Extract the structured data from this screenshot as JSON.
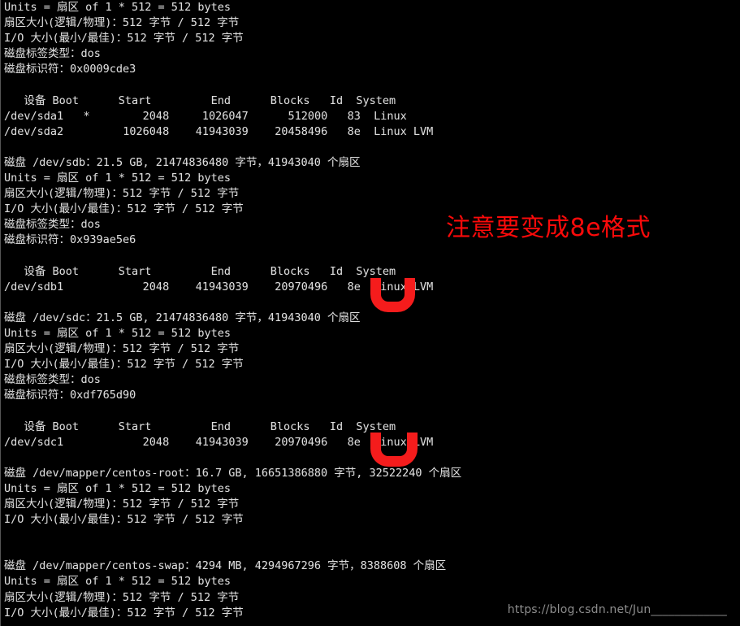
{
  "terminal": {
    "background_color": "#000000",
    "foreground_color": "#dcdcdc",
    "accent_color": "#fb0a0a",
    "console_text": "Units = 扇区 of 1 * 512 = 512 bytes\n扇区大小(逻辑/物理)：512 字节 / 512 字节\nI/O 大小(最小/最佳)：512 字节 / 512 字节\n磁盘标签类型：dos\n磁盘标识符：0x0009cde3\n\n   设备 Boot      Start         End      Blocks   Id  System\n/dev/sda1   *        2048     1026047      512000   83  Linux\n/dev/sda2         1026048    41943039    20458496   8e  Linux LVM\n\n磁盘 /dev/sdb：21.5 GB, 21474836480 字节，41943040 个扇区\nUnits = 扇区 of 1 * 512 = 512 bytes\n扇区大小(逻辑/物理)：512 字节 / 512 字节\nI/O 大小(最小/最佳)：512 字节 / 512 字节\n磁盘标签类型：dos\n磁盘标识符：0x939ae5e6\n\n   设备 Boot      Start         End      Blocks   Id  System\n/dev/sdb1            2048    41943039    20970496   8e  Linux LVM\n\n磁盘 /dev/sdc：21.5 GB, 21474836480 字节，41943040 个扇区\nUnits = 扇区 of 1 * 512 = 512 bytes\n扇区大小(逻辑/物理)：512 字节 / 512 字节\nI/O 大小(最小/最佳)：512 字节 / 512 字节\n磁盘标签类型：dos\n磁盘标识符：0xdf765d90\n\n   设备 Boot      Start         End      Blocks   Id  System\n/dev/sdc1            2048    41943039    20970496   8e  Linux LVM\n\n磁盘 /dev/mapper/centos-root：16.7 GB, 16651386880 字节, 32522240 个扇区\nUnits = 扇区 of 1 * 512 = 512 bytes\n扇区大小(逻辑/物理)：512 字节 / 512 字节\nI/O 大小(最小/最佳)：512 字节 / 512 字节\n\n\n磁盘 /dev/mapper/centos-swap：4294 MB, 4294967296 字节，8388608 个扇区\nUnits = 扇区 of 1 * 512 = 512 bytes\n扇区大小(逻辑/物理)：512 字节 / 512 字节\nI/O 大小(最小/最佳)：512 字节 / 512 字节"
  },
  "annotations": {
    "note": "注意要变成8e格式",
    "marker_sdb1_label": "u-shaped-highlight-on-8e",
    "marker_sdc1_label": "u-shaped-highlight-on-8e"
  },
  "watermark": {
    "text": "https://blog.csdn.net/Jun_____________"
  },
  "disks": [
    {
      "device": "/dev/sda",
      "units": "Units = 扇区 of 1 * 512 = 512 bytes",
      "sector_size": "扇区大小(逻辑/物理)：512 字节 / 512 字节",
      "io_size": "I/O 大小(最小/最佳)：512 字节 / 512 字节",
      "label_type": "磁盘标签类型：dos",
      "identifier": "磁盘标识符：0x0009cde3",
      "table_header": [
        "设备",
        "Boot",
        "Start",
        "End",
        "Blocks",
        "Id",
        "System"
      ],
      "partitions": [
        {
          "device": "/dev/sda1",
          "boot": "*",
          "start": "2048",
          "end": "1026047",
          "blocks": "512000",
          "id": "83",
          "system": "Linux"
        },
        {
          "device": "/dev/sda2",
          "boot": "",
          "start": "1026048",
          "end": "41943039",
          "blocks": "20458496",
          "id": "8e",
          "system": "Linux LVM"
        }
      ]
    },
    {
      "device": "/dev/sdb",
      "header": "磁盘 /dev/sdb：21.5 GB, 21474836480 字节，41943040 个扇区",
      "size_gb": "21.5 GB",
      "size_bytes": "21474836480",
      "sectors": "41943040",
      "units": "Units = 扇区 of 1 * 512 = 512 bytes",
      "sector_size": "扇区大小(逻辑/物理)：512 字节 / 512 字节",
      "io_size": "I/O 大小(最小/最佳)：512 字节 / 512 字节",
      "label_type": "磁盘标签类型：dos",
      "identifier": "磁盘标识符：0x939ae5e6",
      "table_header": [
        "设备",
        "Boot",
        "Start",
        "End",
        "Blocks",
        "Id",
        "System"
      ],
      "partitions": [
        {
          "device": "/dev/sdb1",
          "boot": "",
          "start": "2048",
          "end": "41943039",
          "blocks": "20970496",
          "id": "8e",
          "system": "Linux LVM"
        }
      ]
    },
    {
      "device": "/dev/sdc",
      "header": "磁盘 /dev/sdc：21.5 GB, 21474836480 字节，41943040 个扇区",
      "size_gb": "21.5 GB",
      "size_bytes": "21474836480",
      "sectors": "41943040",
      "units": "Units = 扇区 of 1 * 512 = 512 bytes",
      "sector_size": "扇区大小(逻辑/物理)：512 字节 / 512 字节",
      "io_size": "I/O 大小(最小/最佳)：512 字节 / 512 字节",
      "label_type": "磁盘标签类型：dos",
      "identifier": "磁盘标识符：0xdf765d90",
      "table_header": [
        "设备",
        "Boot",
        "Start",
        "End",
        "Blocks",
        "Id",
        "System"
      ],
      "partitions": [
        {
          "device": "/dev/sdc1",
          "boot": "",
          "start": "2048",
          "end": "41943039",
          "blocks": "20970496",
          "id": "8e",
          "system": "Linux LVM"
        }
      ]
    },
    {
      "device": "/dev/mapper/centos-root",
      "header": "磁盘 /dev/mapper/centos-root：16.7 GB, 16651386880 字节, 32522240 个扇区",
      "size_gb": "16.7 GB",
      "size_bytes": "16651386880",
      "sectors": "32522240",
      "units": "Units = 扇区 of 1 * 512 = 512 bytes",
      "sector_size": "扇区大小(逻辑/物理)：512 字节 / 512 字节",
      "io_size": "I/O 大小(最小/最佳)：512 字节 / 512 字节",
      "partitions": []
    },
    {
      "device": "/dev/mapper/centos-swap",
      "header": "磁盘 /dev/mapper/centos-swap：4294 MB, 4294967296 字节，8388608 个扇区",
      "size_gb": "4294 MB",
      "size_bytes": "4294967296",
      "sectors": "8388608",
      "units": "Units = 扇区 of 1 * 512 = 512 bytes",
      "sector_size": "扇区大小(逻辑/物理)：512 字节 / 512 字节",
      "io_size": "I/O 大小(最小/最佳)：512 字节 / 512 字节",
      "partitions": []
    }
  ]
}
